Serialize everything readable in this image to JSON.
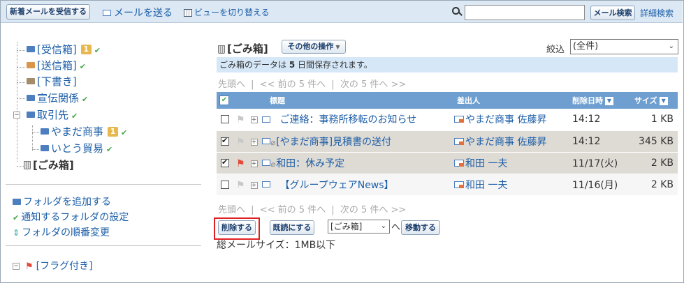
{
  "toolbar": {
    "receive_button": "新着メールを受信する",
    "send_link": "メールを送る",
    "view_toggle": "ビューを切り替える",
    "search_placeholder": "",
    "search_button": "メール検索",
    "advanced_search": "詳細検索"
  },
  "sidebar": {
    "folders": [
      {
        "label": "[受信箱]",
        "badge": "1",
        "notify": true,
        "color": "#4d7fc0"
      },
      {
        "label": "[送信箱]",
        "badge": "",
        "notify": true,
        "color": "#d9964a"
      },
      {
        "label": "[下書き]",
        "badge": "",
        "notify": false,
        "color": "#a48b6a"
      },
      {
        "label": "宣伝関係",
        "badge": "",
        "notify": true,
        "color": "#4d7fc0"
      },
      {
        "label": "取引先",
        "badge": "",
        "notify": true,
        "color": "#4d7fc0"
      },
      {
        "label": "やまだ商事",
        "badge": "1",
        "notify": true,
        "color": "#4d7fc0"
      },
      {
        "label": "いとう貿易",
        "badge": "",
        "notify": true,
        "color": "#4d7fc0"
      },
      {
        "label": "[ごみ箱]",
        "badge": "",
        "notify": false,
        "color": "#888"
      }
    ],
    "add_folder": "フォルダを追加する",
    "notify_settings": "通知するフォルダの設定",
    "reorder_folders": "フォルダの順番変更",
    "flagged": "[フラグ付き]"
  },
  "main": {
    "title": "[ごみ箱]",
    "other_ops": "その他の操作",
    "filter_label": "絞込",
    "filter_value": "(全件)",
    "notice_prefix": "ごみ箱のデータは ",
    "notice_days": "5",
    "notice_suffix": " 日間保存されます。",
    "pager": {
      "first": "先頭へ",
      "prev": "<< 前の 5 件へ",
      "next": "次の 5 件へ >>",
      "sep": "|"
    },
    "columns": {
      "subject": "標題",
      "sender": "差出人",
      "deleted_at": "削除日時",
      "size": "サイズ"
    },
    "rows": [
      {
        "checked": false,
        "flag": "gray",
        "attachment": false,
        "subject": "ご連絡：事務所移転のお知らせ",
        "sender": "やまだ商事 佐藤昇",
        "date": "14:12",
        "size": "1 KB"
      },
      {
        "checked": true,
        "flag": "gray",
        "attachment": true,
        "subject": "[やまだ商事]見積書の送付",
        "sender": "やまだ商事 佐藤昇",
        "date": "14:12",
        "size": "345 KB"
      },
      {
        "checked": true,
        "flag": "red",
        "attachment": true,
        "subject": "和田：休み予定",
        "sender": "和田 一夫",
        "date": "11/17(火)",
        "size": "2 KB"
      },
      {
        "checked": false,
        "flag": "gray",
        "attachment": false,
        "subject": "【グループウェアNews】",
        "sender": "和田 一夫",
        "date": "11/16(月)",
        "size": "2 KB"
      }
    ],
    "actions": {
      "delete": "削除する",
      "mark_read": "既読にする",
      "move_target": "[ごみ箱]",
      "move_suffix": "へ",
      "move": "移動する"
    },
    "total_size": "総メールサイズ：1MB以下"
  },
  "colors": {
    "header_blue": "#6e9fd0",
    "notice_bg": "#d6e8f8",
    "link": "#1d5fa8",
    "highlight_red": "#e02020",
    "selected_row": "#dedad4"
  }
}
